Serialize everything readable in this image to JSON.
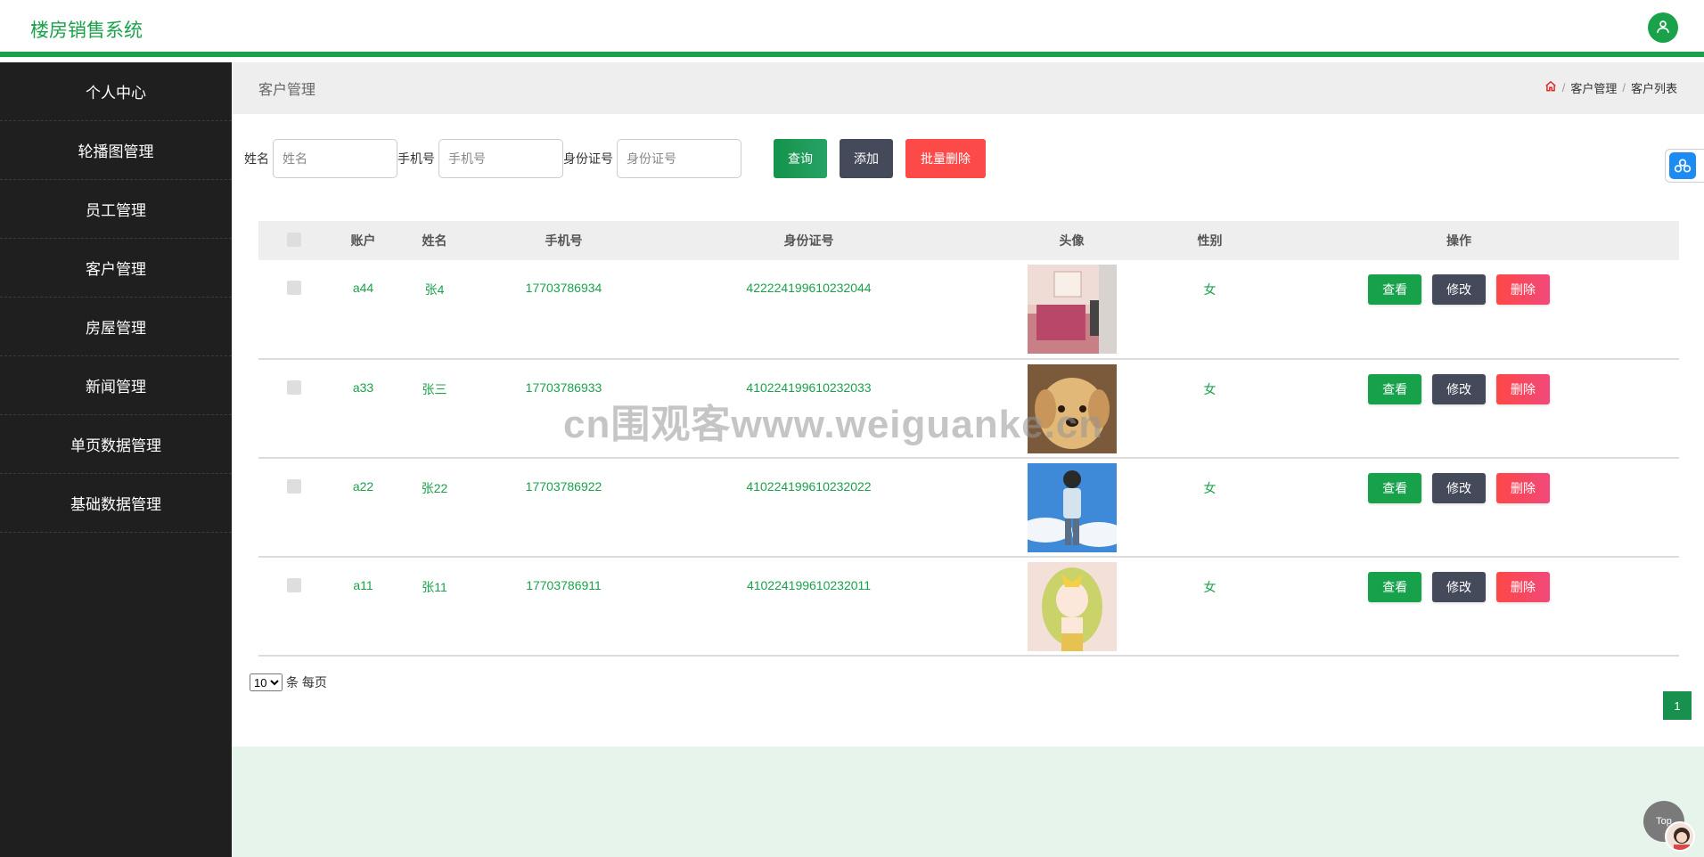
{
  "app": {
    "title": "楼房销售系统"
  },
  "icons": {
    "user": "user-icon",
    "home": "home-icon",
    "tool": "cloud-tool-icon"
  },
  "colors": {
    "brand": "#1aa24b",
    "sidebar": "#1f1f1f",
    "dark_button": "#454a5b",
    "danger": "#fb4a48"
  },
  "sidebar": {
    "items": [
      {
        "label": "个人中心"
      },
      {
        "label": "轮播图管理"
      },
      {
        "label": "员工管理"
      },
      {
        "label": "客户管理"
      },
      {
        "label": "房屋管理"
      },
      {
        "label": "新闻管理"
      },
      {
        "label": "单页数据管理"
      },
      {
        "label": "基础数据管理"
      }
    ]
  },
  "page": {
    "title": "客户管理",
    "breadcrumb": [
      "客户管理",
      "客户列表"
    ]
  },
  "search": {
    "name_label": "姓名",
    "name_placeholder": "姓名",
    "phone_label": "手机号",
    "phone_placeholder": "手机号",
    "id_label": "身份证号",
    "id_placeholder": "身份证号",
    "query_label": "查询",
    "add_label": "添加",
    "batch_delete_label": "批量删除"
  },
  "table": {
    "headers": {
      "account": "账户",
      "name": "姓名",
      "phone": "手机号",
      "idcard": "身份证号",
      "avatar": "头像",
      "gender": "性别",
      "ops": "操作"
    },
    "rows": [
      {
        "account": "a44",
        "name": "张4",
        "phone": "17703786934",
        "idcard": "422224199610232044",
        "gender": "女",
        "avatar": "room-photo"
      },
      {
        "account": "a33",
        "name": "张三",
        "phone": "17703786933",
        "idcard": "410224199610232033",
        "gender": "女",
        "avatar": "puppy-photo"
      },
      {
        "account": "a22",
        "name": "张22",
        "phone": "17703786922",
        "idcard": "410224199610232022",
        "gender": "女",
        "avatar": "boy-sky-illustration"
      },
      {
        "account": "a11",
        "name": "张11",
        "phone": "17703786911",
        "idcard": "410224199610232011",
        "gender": "女",
        "avatar": "girl-illustration"
      }
    ],
    "ops": {
      "view": "查看",
      "edit": "修改",
      "delete": "删除"
    }
  },
  "pagination": {
    "page_size": "10",
    "per_page_text": "条 每页",
    "current_page": "1"
  },
  "watermark": "cn围观客www.weiguanke.cn",
  "floating": {
    "top_label": "Top"
  }
}
